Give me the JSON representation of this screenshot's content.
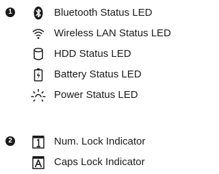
{
  "groups": [
    {
      "marker": "1",
      "items": [
        {
          "icon": "bluetooth-icon",
          "label": "Bluetooth Status LED"
        },
        {
          "icon": "wireless-lan-icon",
          "label": "Wireless LAN Status LED"
        },
        {
          "icon": "hdd-icon",
          "label": "HDD Status LED"
        },
        {
          "icon": "battery-icon",
          "label": "Battery Status LED"
        },
        {
          "icon": "power-sun-icon",
          "label": "Power Status LED"
        }
      ]
    },
    {
      "marker": "2",
      "items": [
        {
          "icon": "num-lock-icon",
          "label": "Num. Lock Indicator"
        },
        {
          "icon": "caps-lock-icon",
          "label": "Caps Lock Indicator"
        }
      ]
    }
  ]
}
